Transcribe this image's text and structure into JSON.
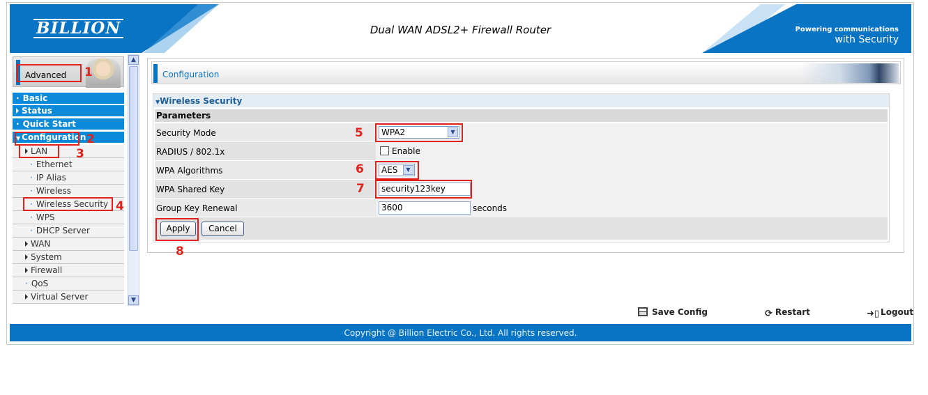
{
  "header": {
    "logo": "BILLION",
    "product_title": "Dual WAN ADSL2+ Firewall Router",
    "tagline_line1": "Powering communications",
    "tagline_line2": "with Security"
  },
  "sidebar": {
    "mode_label": "Advanced",
    "main_items": [
      "Basic",
      "Status",
      "Quick Start",
      "Configuration"
    ],
    "sub_items": [
      {
        "label": "LAN",
        "level": 1,
        "expandable": true
      },
      {
        "label": "Ethernet",
        "level": 2
      },
      {
        "label": "IP Alias",
        "level": 2
      },
      {
        "label": "Wireless",
        "level": 2
      },
      {
        "label": "Wireless Security",
        "level": 2,
        "selected": true
      },
      {
        "label": "WPS",
        "level": 2
      },
      {
        "label": "DHCP Server",
        "level": 2
      },
      {
        "label": "WAN",
        "level": 1,
        "expandable": true
      },
      {
        "label": "System",
        "level": 1,
        "expandable": true
      },
      {
        "label": "Firewall",
        "level": 1,
        "expandable": true
      },
      {
        "label": "QoS",
        "level": 1
      },
      {
        "label": "Virtual Server",
        "level": 1,
        "expandable": true
      }
    ]
  },
  "content": {
    "title": "Configuration",
    "panel_title": "Wireless Security",
    "params_header": "Parameters",
    "fields": {
      "security_mode": {
        "label": "Security Mode",
        "value": "WPA2"
      },
      "radius": {
        "label": "RADIUS / 802.1x",
        "checkbox_label": "Enable",
        "checked": false
      },
      "wpa_algorithms": {
        "label": "WPA Algorithms",
        "value": "AES"
      },
      "wpa_shared_key": {
        "label": "WPA Shared Key",
        "value": "security123key"
      },
      "group_key_renewal": {
        "label": "Group Key Renewal",
        "value": "3600",
        "unit": "seconds"
      }
    },
    "apply_label": "Apply",
    "cancel_label": "Cancel"
  },
  "annotations": [
    "1",
    "2",
    "3",
    "4",
    "5",
    "6",
    "7",
    "8"
  ],
  "footer": {
    "save_config": "Save Config",
    "restart": "Restart",
    "logout": "Logout",
    "copyright": "Copyright @ Billion Electric Co., Ltd. All rights reserved."
  },
  "colors": {
    "brand_blue": "#0a74c4",
    "menu_blue": "#0a8ad8",
    "annotation_red": "#e2211c"
  },
  "icons": {
    "save": "floppy-icon",
    "restart": "restart-icon",
    "logout": "logout-icon"
  }
}
